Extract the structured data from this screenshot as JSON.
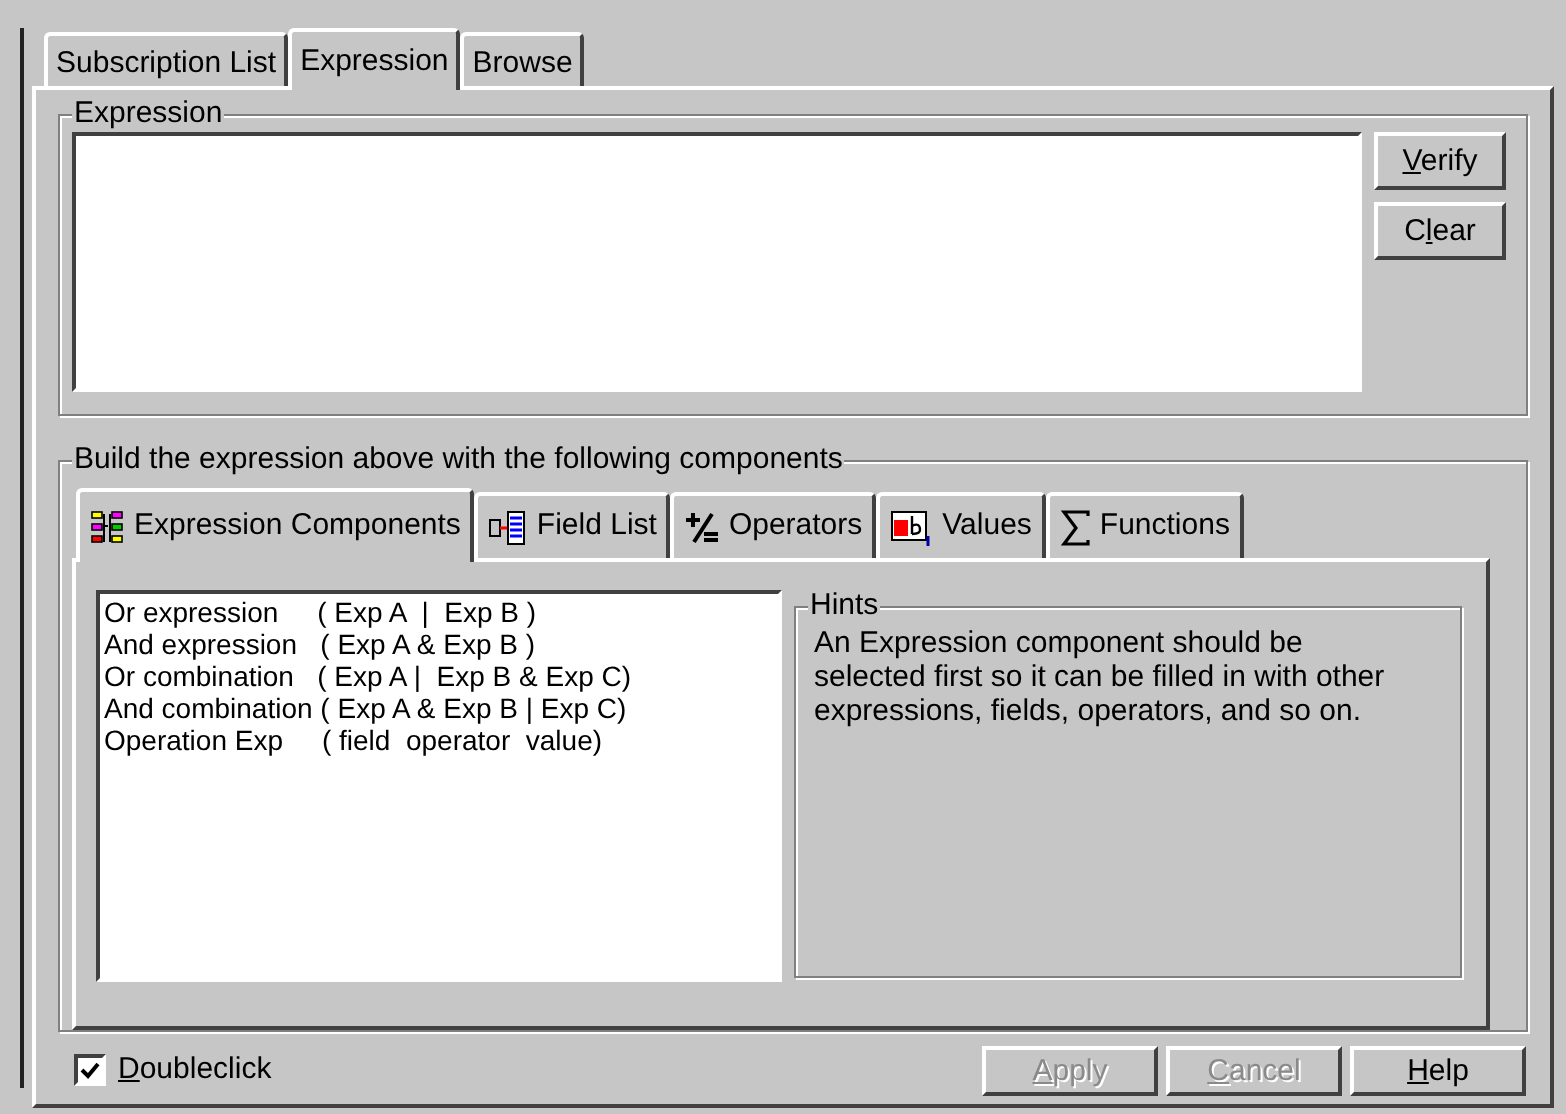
{
  "tabs": [
    {
      "label": "Subscription List",
      "selected": false
    },
    {
      "label": "Expression",
      "selected": true
    },
    {
      "label": "Browse",
      "selected": false
    }
  ],
  "expression_group": {
    "title": "Expression",
    "buttons": [
      {
        "key": "V",
        "after": "erify",
        "disabled": false
      },
      {
        "before": "C",
        "key": "l",
        "after": "ear",
        "disabled": false
      }
    ]
  },
  "build_group": {
    "title": "Build the expression above with the following components",
    "tabs": [
      {
        "label": "Expression Components",
        "selected": true
      },
      {
        "label": "Field List",
        "selected": false
      },
      {
        "label": "Operators",
        "selected": false
      },
      {
        "label": "Values",
        "selected": false
      },
      {
        "label": "Functions",
        "selected": false
      }
    ],
    "list": [
      "Or expression     ( Exp A  |  Exp B )",
      "And expression   ( Exp A & Exp B )",
      "Or combination   ( Exp A |  Exp B & Exp C)",
      "And combination ( Exp A & Exp B | Exp C)",
      "Operation Exp     ( field  operator  value)"
    ],
    "hints": {
      "title": "Hints",
      "text": "An Expression component should be selected first so it can be filled in with other expressions, fields, operators, and so on."
    }
  },
  "doubleclick": {
    "key": "D",
    "after": "oubleclick",
    "checked": true
  },
  "buttons": [
    {
      "key": "A",
      "after": "pply",
      "disabled": true
    },
    {
      "key": "C",
      "after": "ancel",
      "disabled": true
    },
    {
      "key": "H",
      "after": "elp",
      "disabled": false
    }
  ]
}
